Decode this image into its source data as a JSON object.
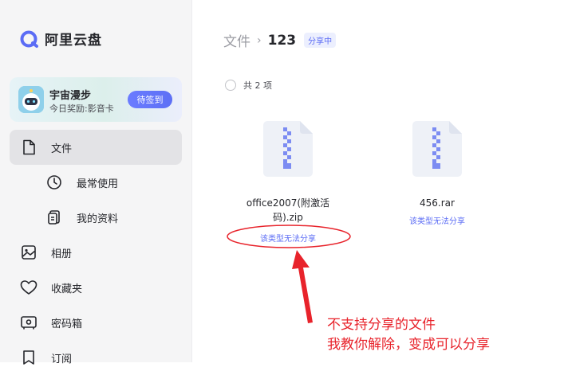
{
  "brand": {
    "name": "阿里云盘",
    "accent": "#5b6cf5"
  },
  "promo": {
    "title": "宇宙漫步",
    "subtitle": "今日奖励:影音卡",
    "button": "待签到"
  },
  "nav": [
    {
      "label": "文件",
      "icon": "file-icon",
      "active": true
    },
    {
      "label": "最常使用",
      "icon": "clock-icon",
      "active": false
    },
    {
      "label": "我的资料",
      "icon": "documents-icon",
      "active": false
    },
    {
      "label": "相册",
      "icon": "album-icon",
      "active": false
    },
    {
      "label": "收藏夹",
      "icon": "heart-icon",
      "active": false
    },
    {
      "label": "密码箱",
      "icon": "safe-icon",
      "active": false
    },
    {
      "label": "订阅",
      "icon": "subscribe-icon",
      "active": false
    }
  ],
  "breadcrumb": {
    "root": "文件",
    "separator": "›",
    "current": "123",
    "badge": "分享中"
  },
  "list": {
    "count_text": "共 2 项"
  },
  "files": [
    {
      "name_line1": "office2007(附激活",
      "name_line2": "码).zip",
      "warning": "该类型无法分享",
      "icon": "zip-file-icon"
    },
    {
      "name_line1": "456.rar",
      "name_line2": "",
      "warning": "该类型无法分享",
      "icon": "rar-file-icon"
    }
  ],
  "annotation": {
    "line1": "不支持分享的文件",
    "line2": "我教你解除，变成可以分享",
    "color": "#e8232b"
  }
}
